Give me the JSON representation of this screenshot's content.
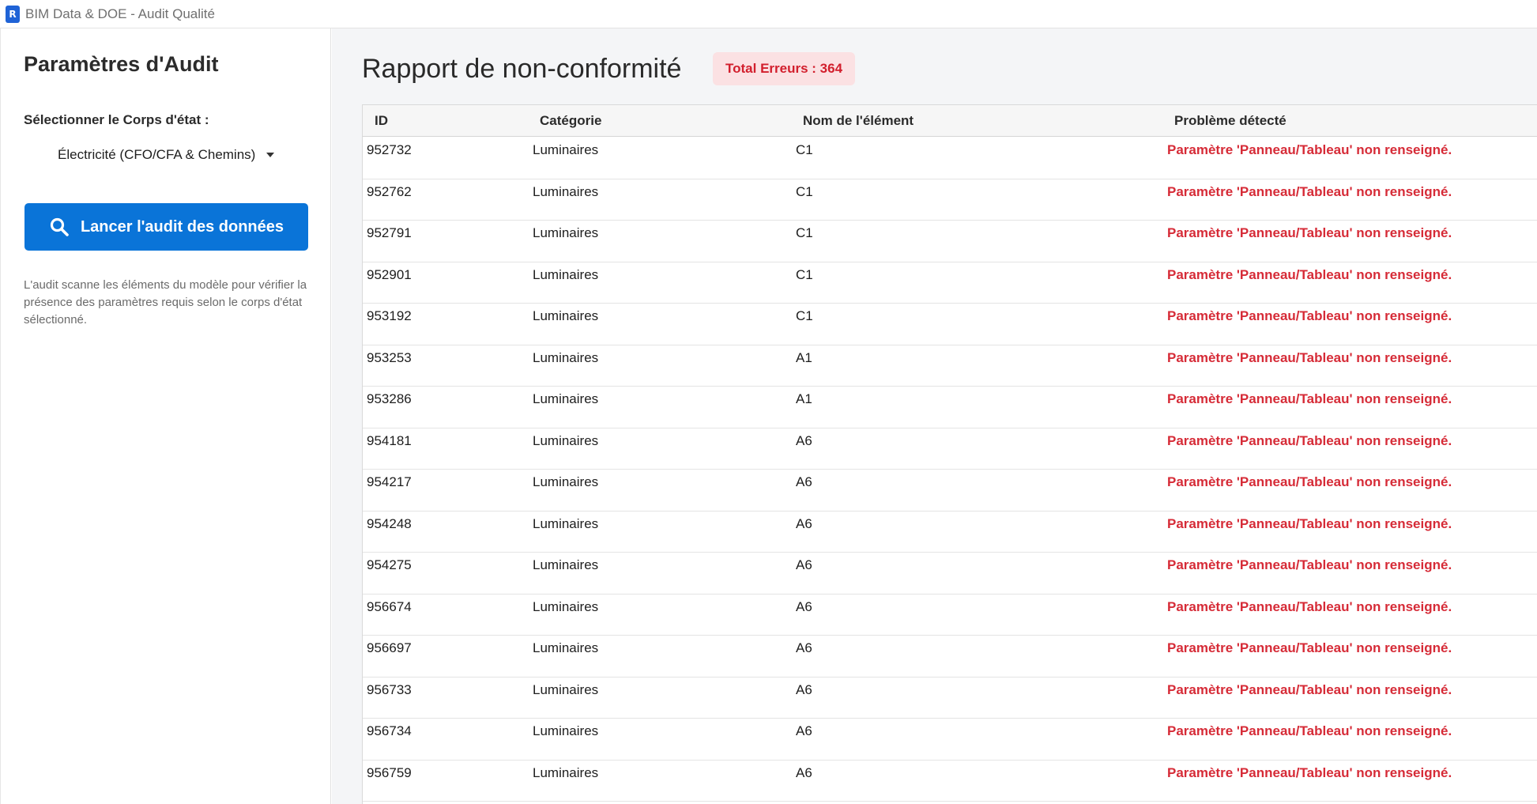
{
  "window": {
    "icon_letter": "R",
    "icon_sub": "",
    "title": "BIM Data & DOE - Audit Qualité"
  },
  "sidebar": {
    "title": "Paramètres d'Audit",
    "select_label": "Sélectionner le Corps d'état :",
    "selected_trade": "Électricité (CFO/CFA & Chemins)",
    "audit_button_label": "Lancer l'audit des données",
    "help_text": "L'audit scanne les éléments du modèle pour vérifier la présence des paramètres requis selon le corps d'état sélectionné."
  },
  "main": {
    "title": "Rapport de non-conformité",
    "total_label": "Total Erreurs :",
    "total_value": "364",
    "columns": [
      "ID",
      "Catégorie",
      "Nom de l'élément",
      "Problème détecté"
    ],
    "rows": [
      {
        "id": "952732",
        "category": "Luminaires",
        "name": "C1",
        "problem": "Paramètre 'Panneau/Tableau' non renseigné."
      },
      {
        "id": "952762",
        "category": "Luminaires",
        "name": "C1",
        "problem": "Paramètre 'Panneau/Tableau' non renseigné."
      },
      {
        "id": "952791",
        "category": "Luminaires",
        "name": "C1",
        "problem": "Paramètre 'Panneau/Tableau' non renseigné."
      },
      {
        "id": "952901",
        "category": "Luminaires",
        "name": "C1",
        "problem": "Paramètre 'Panneau/Tableau' non renseigné."
      },
      {
        "id": "953192",
        "category": "Luminaires",
        "name": "C1",
        "problem": "Paramètre 'Panneau/Tableau' non renseigné."
      },
      {
        "id": "953253",
        "category": "Luminaires",
        "name": "A1",
        "problem": "Paramètre 'Panneau/Tableau' non renseigné."
      },
      {
        "id": "953286",
        "category": "Luminaires",
        "name": "A1",
        "problem": "Paramètre 'Panneau/Tableau' non renseigné."
      },
      {
        "id": "954181",
        "category": "Luminaires",
        "name": "A6",
        "problem": "Paramètre 'Panneau/Tableau' non renseigné."
      },
      {
        "id": "954217",
        "category": "Luminaires",
        "name": "A6",
        "problem": "Paramètre 'Panneau/Tableau' non renseigné."
      },
      {
        "id": "954248",
        "category": "Luminaires",
        "name": "A6",
        "problem": "Paramètre 'Panneau/Tableau' non renseigné."
      },
      {
        "id": "954275",
        "category": "Luminaires",
        "name": "A6",
        "problem": "Paramètre 'Panneau/Tableau' non renseigné."
      },
      {
        "id": "956674",
        "category": "Luminaires",
        "name": "A6",
        "problem": "Paramètre 'Panneau/Tableau' non renseigné."
      },
      {
        "id": "956697",
        "category": "Luminaires",
        "name": "A6",
        "problem": "Paramètre 'Panneau/Tableau' non renseigné."
      },
      {
        "id": "956733",
        "category": "Luminaires",
        "name": "A6",
        "problem": "Paramètre 'Panneau/Tableau' non renseigné."
      },
      {
        "id": "956734",
        "category": "Luminaires",
        "name": "A6",
        "problem": "Paramètre 'Panneau/Tableau' non renseigné."
      },
      {
        "id": "956759",
        "category": "Luminaires",
        "name": "A6",
        "problem": "Paramètre 'Panneau/Tableau' non renseigné."
      }
    ]
  },
  "colors": {
    "accent": "#0a74d8",
    "error_text": "#d62b37",
    "error_badge_bg": "#fbe1e3"
  }
}
